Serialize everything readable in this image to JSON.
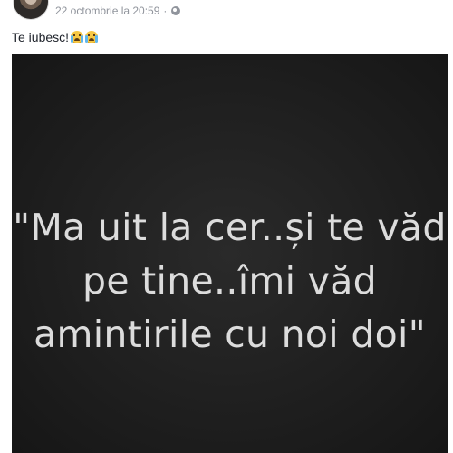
{
  "post": {
    "date_text": "22 octombrie la 20:59",
    "separator": "·",
    "privacy_icon": "globe-icon",
    "text": "Te iubesc!",
    "emojis": [
      "crying-face-emoji",
      "crying-face-emoji"
    ]
  },
  "photo": {
    "quote_lines": [
      "\"Ma uit la cer..și te văd",
      "pe tine..îmi văd",
      "amintirile cu noi doi\""
    ]
  }
}
